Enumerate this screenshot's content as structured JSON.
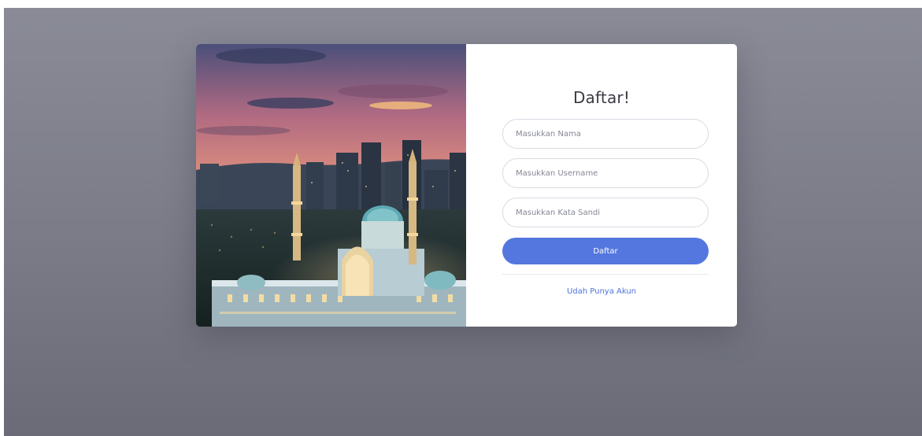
{
  "register": {
    "title": "Daftar!",
    "name_placeholder": "Masukkan Nama",
    "username_placeholder": "Masukkan Username",
    "password_placeholder": "Masukkan Kata Sandi",
    "submit_label": "Daftar",
    "login_link": "Udah Punya Akun"
  },
  "colors": {
    "background": "#7f808c",
    "card": "#ffffff",
    "button": "#5477df",
    "link": "#4e73df"
  }
}
